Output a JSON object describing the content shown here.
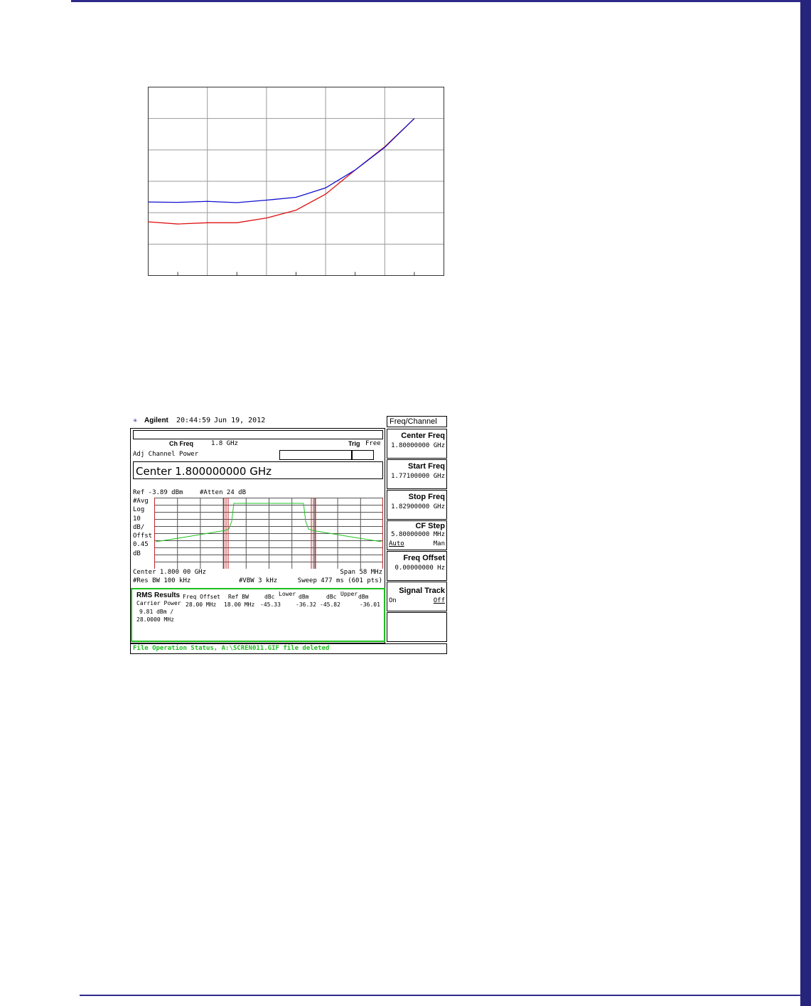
{
  "analyzer": {
    "brand": "Agilent",
    "time": "20:44:59",
    "date": "Jun 19, 2012",
    "menu_title": "Freq/Channel",
    "ch_freq_label": "Ch Freq",
    "ch_freq_value": "1.8 GHz",
    "trig_label": "Trig",
    "trig_value": "Free",
    "measurement": "Adj Channel Power",
    "center_entry": "Center 1.800000000 GHz",
    "ref_level": "Ref -3.89 dBm",
    "atten": "#Atten 24 dB",
    "left_labels": [
      "#Avg",
      "Log",
      "10",
      "dB/",
      "Offst",
      "0.45",
      "dB"
    ],
    "center_text": "Center 1.800 00 GHz",
    "span_text": "Span 58 MHz",
    "rbw_text": "#Res BW 100 kHz",
    "vbw_text": "#VBW 3 kHz",
    "sweep_text": "Sweep 477 ms (601 pts)",
    "results": {
      "title": "RMS Results",
      "carrier_power_label": "Carrier Power",
      "carrier_power_value": "9.81 dBm  /",
      "carrier_bw": "28.0000 MHz",
      "col_freq_offset": "Freq Offset",
      "col_ref_bw": "Ref BW",
      "col_dbc1": "dBc",
      "col_lower": "Lower",
      "col_dbm1": "dBm",
      "col_dbc2": "dBc",
      "col_upper": "Upper",
      "col_dbm2": "dBm",
      "freq_offset": "28.00 MHz",
      "ref_bw": "18.00 MHz",
      "lower_dbc": "-45.33",
      "lower_dbm": "-36.32",
      "upper_dbc": "-45.82",
      "upper_dbm": "-36.01"
    },
    "softkeys": [
      {
        "title": "Center Freq",
        "value": "1.80000000 GHz"
      },
      {
        "title": "Start Freq",
        "value": "1.77100000 GHz"
      },
      {
        "title": "Stop Freq",
        "value": "1.82900000 GHz"
      },
      {
        "title": "CF Step",
        "value": "5.80000000 MHz",
        "opt_left": "Auto",
        "opt_right": "Man"
      },
      {
        "title": "Freq Offset",
        "value": "0.00000000  Hz"
      },
      {
        "title": "Signal Track",
        "opt_left": "On",
        "opt_right": "Off"
      }
    ],
    "status_bar": "File Operation Status, A:\\SCREN011.GIF file deleted",
    "trace_color": "#22c322",
    "line_color": "#c0282d"
  },
  "line_chart": {
    "colors": {
      "series_a": "#1010d0",
      "series_b": "#e01010"
    }
  },
  "chart_data": {
    "type": "line",
    "title": "",
    "xlabel": "",
    "ylabel": "",
    "x": [
      0,
      1,
      2,
      3,
      4,
      5,
      6,
      7,
      8,
      9
    ],
    "xlim": [
      0,
      10
    ],
    "ylim": [
      0,
      6
    ],
    "grid": true,
    "series": [
      {
        "values": [
          2.34,
          2.33,
          2.36,
          2.32,
          2.4,
          2.49,
          2.79,
          3.36,
          4.08,
          5.0
        ]
      },
      {
        "values": [
          1.71,
          1.64,
          1.68,
          1.68,
          1.83,
          2.08,
          2.59,
          3.36,
          4.1,
          5.0
        ]
      }
    ]
  }
}
